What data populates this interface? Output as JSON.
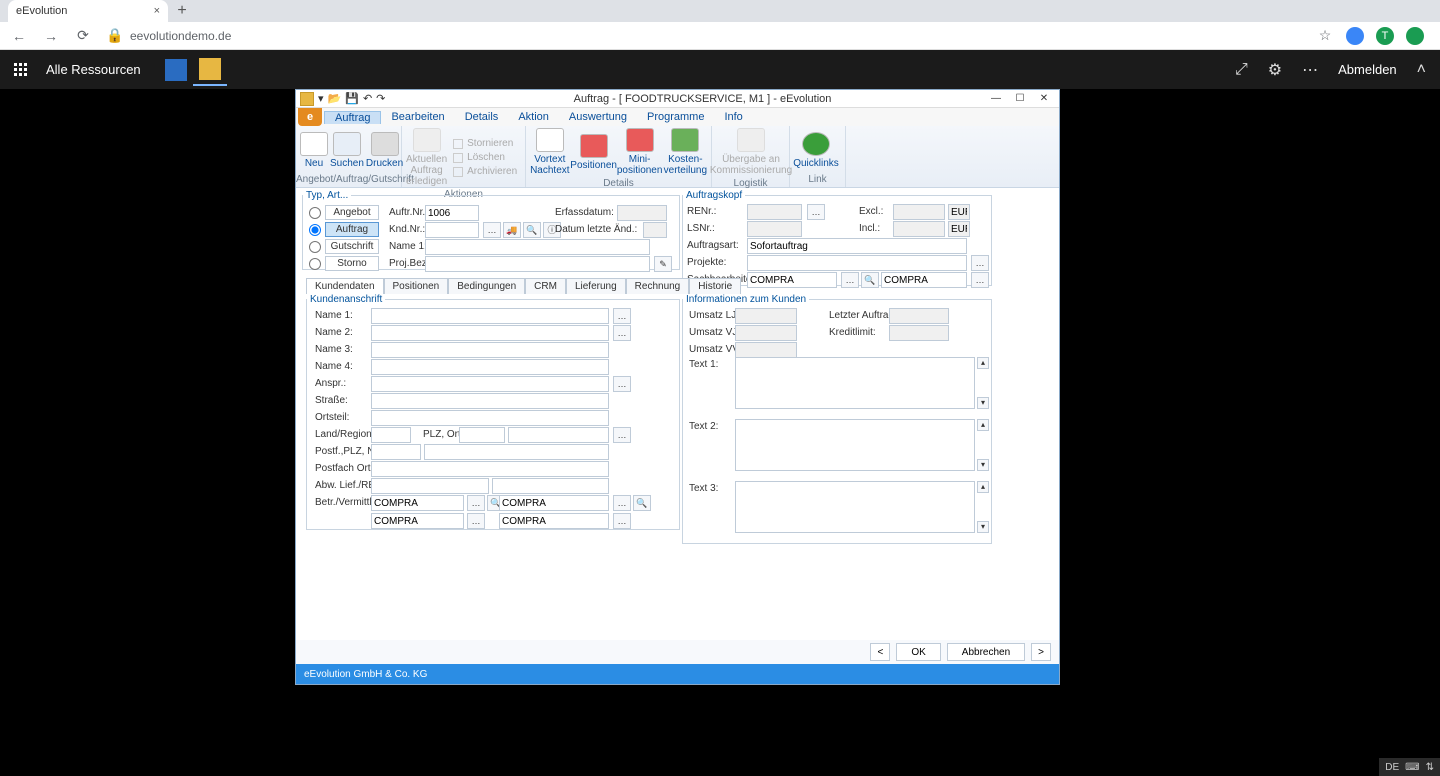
{
  "browser": {
    "tab_title": "eEvolution",
    "url": "eevolutiondemo.de"
  },
  "session_bar": {
    "resources_label": "Alle Ressourcen",
    "logout_label": "Abmelden"
  },
  "window": {
    "title": "Auftrag - [ FOODTRUCKSERVICE, M1 ]  -  eEvolution"
  },
  "menus": [
    "Auftrag",
    "Bearbeiten",
    "Details",
    "Aktion",
    "Auswertung",
    "Programme",
    "Info"
  ],
  "ribbon": {
    "group1": {
      "label": "Angebot/Auftrag/Gutschrift",
      "buttons": [
        "Neu",
        "Suchen",
        "Drucken"
      ]
    },
    "group2": {
      "label": "Aktionen",
      "big": "Aktuellen Auftrag erledigen",
      "small": [
        "Stornieren",
        "Löschen",
        "Archivieren"
      ]
    },
    "group3": {
      "label": "Details",
      "buttons": [
        "Vortext Nachtext",
        "Positionen",
        "Mini-positionen",
        "Kosten-verteilung"
      ]
    },
    "group4": {
      "label": "Logistik",
      "buttons": [
        "Übergabe an Kommissionierung"
      ]
    },
    "group5": {
      "label": "Link",
      "buttons": [
        "Quicklinks"
      ]
    }
  },
  "typ_art": {
    "legend": "Typ, Art...",
    "options": [
      "Angebot",
      "Auftrag",
      "Gutschrift",
      "Storno"
    ],
    "selected": "Auftrag"
  },
  "header_fields": {
    "auftr_nr_label": "Auftr.Nr.:",
    "auftr_nr_value": "1006",
    "knd_nr_label": "Knd.Nr.:",
    "name1_label": "Name 1:",
    "proj_bez_label": "Proj.Bez.:",
    "erfassdatum_label": "Erfassdatum:",
    "datum_letzte_label": "Datum letzte Änd.:"
  },
  "auftragskopf": {
    "legend": "Auftragskopf",
    "renr_label": "RENr.:",
    "lsnr_label": "LSNr.:",
    "auftragsart_label": "Auftragsart:",
    "auftragsart_value": "Sofortauftrag",
    "projekte_label": "Projekte:",
    "sachbearbeiter_label": "Sachbearbeiter:",
    "sach_value": "COMPRA",
    "sach_value2": "COMPRA",
    "excl_label": "Excl.:",
    "incl_label": "Incl.:",
    "cur": "EUR"
  },
  "tabs": [
    "Kundendaten",
    "Positionen",
    "Bedingungen",
    "CRM",
    "Lieferung",
    "Rechnung",
    "Historie"
  ],
  "kundenanschrift": {
    "legend": "Kundenanschrift",
    "labels": {
      "name1": "Name 1:",
      "name2": "Name 2:",
      "name3": "Name 3:",
      "name4": "Name 4:",
      "anspr": "Anspr.:",
      "strasse": "Straße:",
      "ortsteil": "Ortsteil:",
      "land": "Land/Region:",
      "plz_ort": "PLZ, Ort:",
      "postf_plz": "Postf.,PLZ, Nr.:",
      "postfach_ort": "Postfach Ort:",
      "abw_lief": "Abw. Lief./RE.:",
      "betr": "Betr./Vermittler:"
    },
    "betr_values": [
      "COMPRA",
      "COMPRA",
      "COMPRA",
      "COMPRA"
    ]
  },
  "info_kunden": {
    "legend": "Informationen zum Kunden",
    "labels": {
      "umsatz_lj": "Umsatz LJ:",
      "umsatz_vj": "Umsatz VJ:",
      "umsatz_vvj": "Umsatz VVJ:",
      "letzter_auftrag": "Letzter Auftrag:",
      "kreditlimit": "Kreditlimit:",
      "text1": "Text 1:",
      "text2": "Text 2:",
      "text3": "Text 3:"
    }
  },
  "footer": {
    "prev": "<",
    "ok": "OK",
    "cancel": "Abbrechen",
    "next": ">"
  },
  "statusbar": "eEvolution GmbH & Co. KG",
  "lang_tray": "DE"
}
